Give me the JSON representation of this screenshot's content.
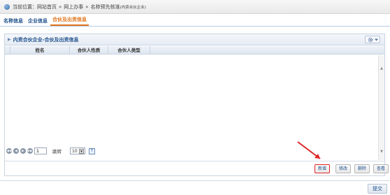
{
  "breadcrumb": {
    "prefix": "当前位置：",
    "items": [
      "网站首页",
      "网上办事",
      "名称预先核准"
    ],
    "separator": "»",
    "suffix": "(内资合伙企业)"
  },
  "tabs": [
    {
      "label": "名称信息",
      "active": false
    },
    {
      "label": "企业信息",
      "active": false
    },
    {
      "label": "合伙及出资信息",
      "active": true
    }
  ],
  "panel": {
    "title": "内资合伙企业-合伙及出资信息"
  },
  "grid": {
    "columns": [
      "",
      "姓名",
      "合伙人性质",
      "合伙人类型"
    ]
  },
  "pager": {
    "page_value": "1",
    "go_label": "跳转",
    "page_size": "10"
  },
  "actions": {
    "add": "新增",
    "edit": "修改",
    "delete": "删除",
    "view": "查看"
  },
  "submit": "提交",
  "colors": {
    "accent_blue": "#1d4f8a",
    "active_tab": "#e0731a",
    "highlight_red": "#e02424"
  }
}
